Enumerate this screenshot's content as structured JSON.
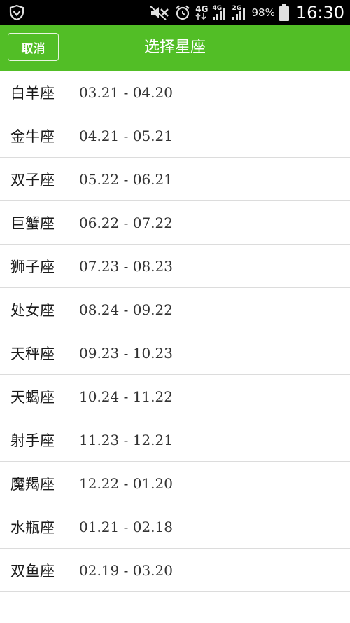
{
  "status_bar": {
    "network_primary": "4G",
    "network_secondary_1": "4G",
    "network_secondary_2": "2G",
    "battery_percent": "98%",
    "time": "16:30"
  },
  "title_bar": {
    "cancel_label": "取消",
    "title": "选择星座",
    "background_color": "#52be26"
  },
  "zodiac_signs": [
    {
      "name": "白羊座",
      "dates": "03.21 - 04.20"
    },
    {
      "name": "金牛座",
      "dates": "04.21 - 05.21"
    },
    {
      "name": "双子座",
      "dates": "05.22 - 06.21"
    },
    {
      "name": "巨蟹座",
      "dates": "06.22 - 07.22"
    },
    {
      "name": "狮子座",
      "dates": "07.23 - 08.23"
    },
    {
      "name": "处女座",
      "dates": "08.24 - 09.22"
    },
    {
      "name": "天秤座",
      "dates": "09.23 - 10.23"
    },
    {
      "name": "天蝎座",
      "dates": "10.24 - 11.22"
    },
    {
      "name": "射手座",
      "dates": "11.23 - 12.21"
    },
    {
      "name": "魔羯座",
      "dates": "12.22 - 01.20"
    },
    {
      "name": "水瓶座",
      "dates": "01.21 - 02.18"
    },
    {
      "name": "双鱼座",
      "dates": "02.19 - 03.20"
    }
  ]
}
